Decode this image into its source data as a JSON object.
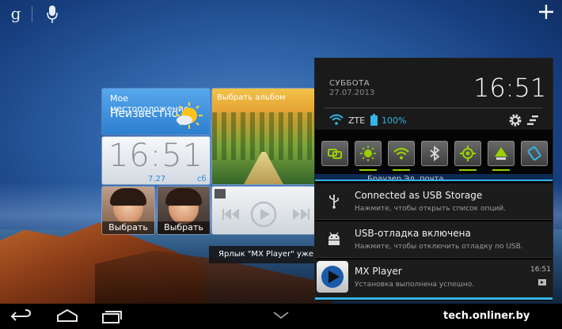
{
  "top_bar": {
    "google_letter": "g",
    "icons": [
      "google-search-icon",
      "mic-icon",
      "plus-icon"
    ]
  },
  "widgets": {
    "location": {
      "title": "Мое местоположение",
      "value": "Неизвестно",
      "icon": "sun-cloud-icon"
    },
    "clock": {
      "time": "16:51",
      "date": "7.27",
      "day": "сб"
    },
    "album": {
      "title": "Выбрать альбом"
    },
    "contacts": [
      {
        "label": "Выбрать"
      },
      {
        "label": "Выбрать"
      }
    ],
    "player": {
      "icons": [
        "prev-icon",
        "play-icon",
        "next-icon"
      ]
    }
  },
  "toast": {
    "text": "Ярлык \"MX Player\" уже сущ"
  },
  "shade": {
    "day": "СУББОТА",
    "date": "27.07.2013",
    "time": "16:51",
    "network": "ZTE",
    "battery": "100%",
    "strip_labels": "Браузер        Эл. почта",
    "toggles": [
      {
        "name": "data-toggle",
        "icon": "data-sync-icon"
      },
      {
        "name": "brightness-toggle",
        "icon": "brightness-icon"
      },
      {
        "name": "wifi-toggle",
        "icon": "wifi-icon"
      },
      {
        "name": "bluetooth-toggle",
        "icon": "bluetooth-icon"
      },
      {
        "name": "gps-toggle",
        "icon": "gps-icon"
      },
      {
        "name": "network-toggle",
        "icon": "network-icon"
      },
      {
        "name": "rotation-toggle",
        "icon": "rotation-icon"
      }
    ],
    "notifications": [
      {
        "title": "Connected as USB Storage",
        "text": "Нажмите, чтобы открыть список опций.",
        "icon": "usb-icon"
      },
      {
        "title": "USB-отладка включена",
        "text": "Нажмите, чтобы отключить отладку по USB.",
        "icon": "android-icon"
      },
      {
        "title": "MX Player",
        "text": "Установка выполнена успешно.",
        "time": "16:51",
        "icon": "mx-player-icon"
      }
    ]
  },
  "nav_bar": {
    "icons": [
      "back-icon",
      "home-icon",
      "recent-apps-icon",
      "shade-handle-icon"
    ],
    "watermark": "tech.onliner.by"
  },
  "colors": {
    "accent": "#33b5e5",
    "toggle_on": "#98d000",
    "tile_blue": "#2d7fd0"
  }
}
